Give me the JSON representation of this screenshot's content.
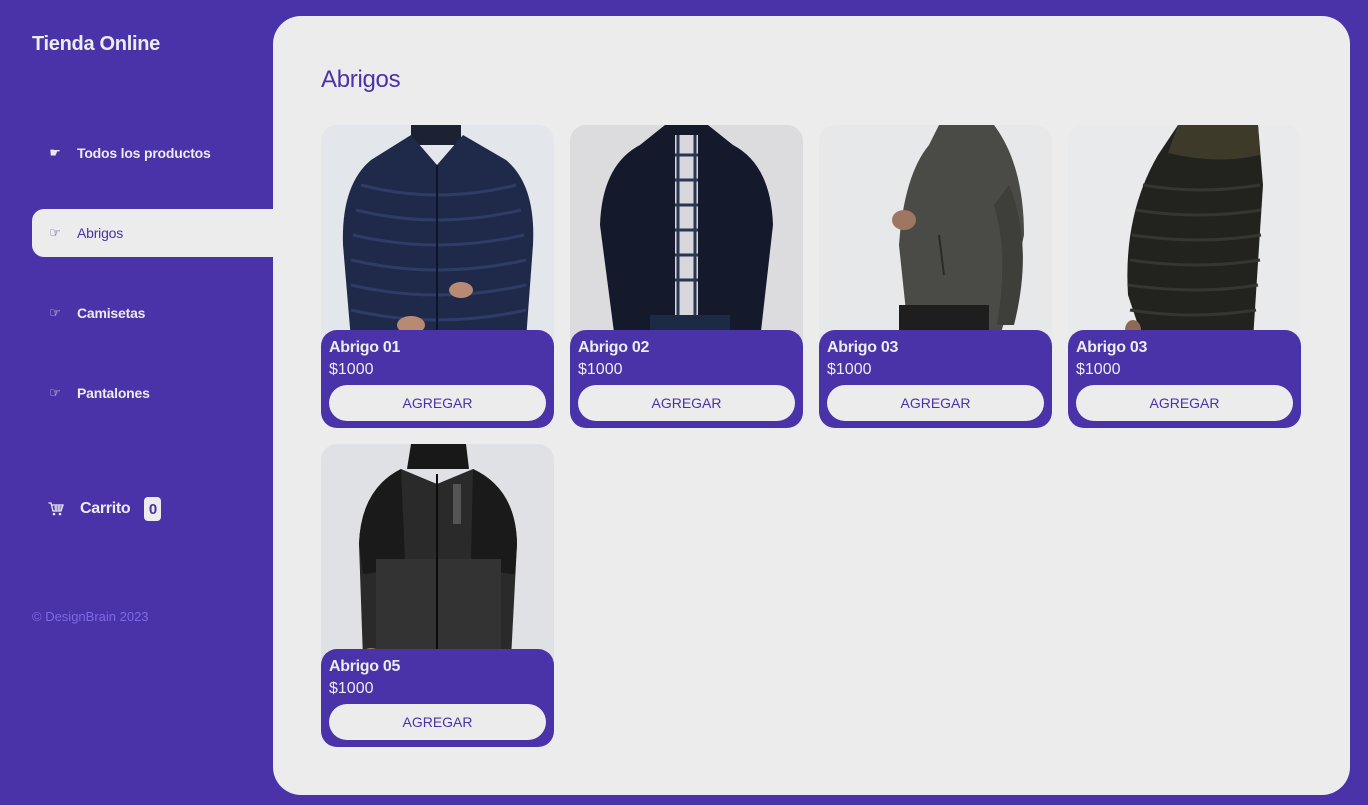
{
  "sidebar": {
    "title": "Tienda Online",
    "items": [
      {
        "label": "Todos los productos",
        "icon": "pointing-hand-solid-icon",
        "active": false
      },
      {
        "label": "Abrigos",
        "icon": "pointing-hand-outline-icon",
        "active": true
      },
      {
        "label": "Camisetas",
        "icon": "pointing-hand-outline-icon",
        "active": false
      },
      {
        "label": "Pantalones",
        "icon": "pointing-hand-outline-icon",
        "active": false
      }
    ],
    "cart": {
      "label": "Carrito",
      "count": "0",
      "icon": "cart-icon"
    },
    "footer": "© DesignBrain 2023"
  },
  "main": {
    "title": "Abrigos",
    "products": [
      {
        "title": "Abrigo 01",
        "price": "$1000",
        "button": "AGREGAR"
      },
      {
        "title": "Abrigo 02",
        "price": "$1000",
        "button": "AGREGAR"
      },
      {
        "title": "Abrigo 03",
        "price": "$1000",
        "button": "AGREGAR"
      },
      {
        "title": "Abrigo 03",
        "price": "$1000",
        "button": "AGREGAR"
      },
      {
        "title": "Abrigo 05",
        "price": "$1000",
        "button": "AGREGAR"
      }
    ]
  },
  "colors": {
    "brand": "#4a32a8",
    "surface": "#ececec",
    "footer_text": "#7d6ae6"
  }
}
